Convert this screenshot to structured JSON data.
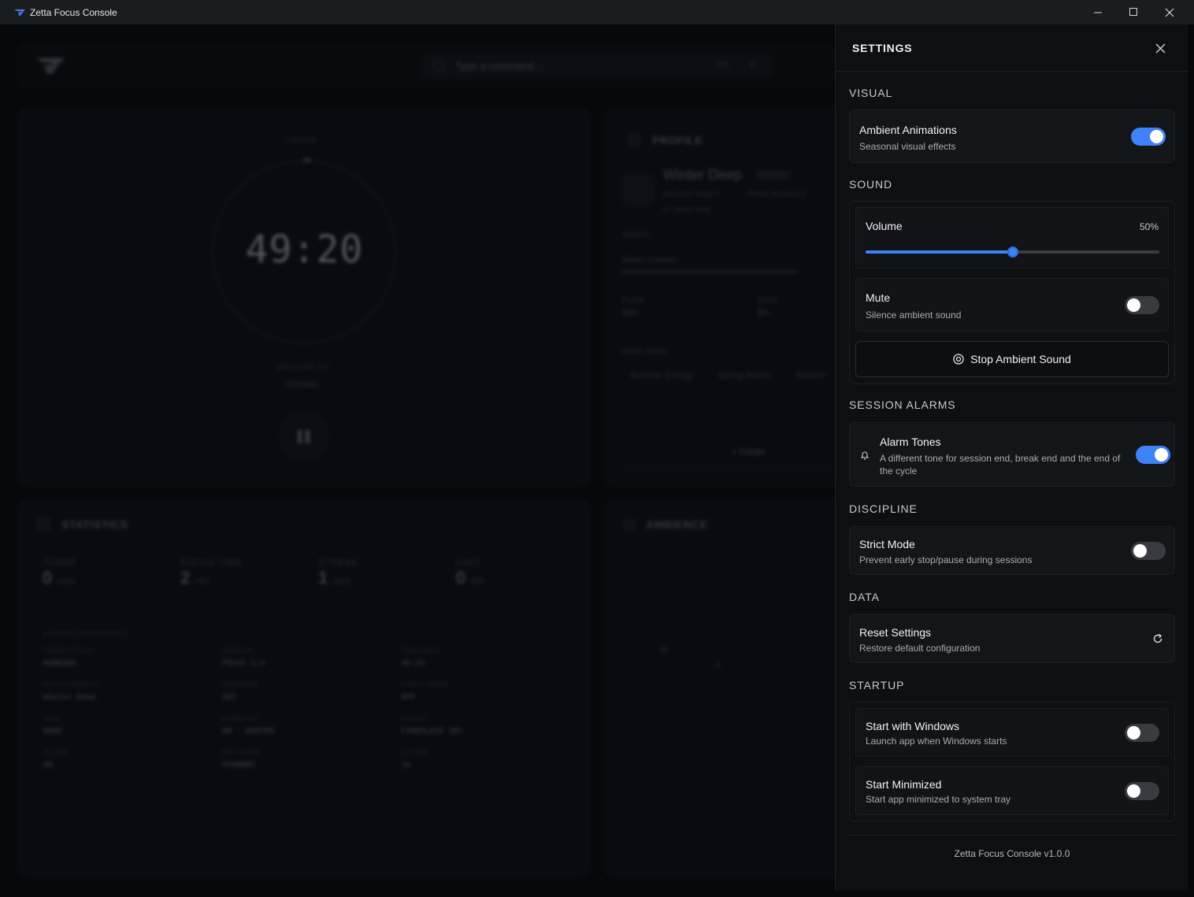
{
  "window": {
    "title": "Zetta Focus Console",
    "controls": [
      "minimize",
      "maximize",
      "close"
    ]
  },
  "background": {
    "command_placeholder": "Type a command...",
    "command_shortcut": "Ctrl",
    "command_shortcut_key": "K",
    "timer": {
      "label": "FOCUS",
      "time": "49:20",
      "session": "SESSION 1/3",
      "badge": "OVERRIDE"
    },
    "profile": {
      "heading": "PROFILE",
      "name": "Winter Deep",
      "badge": "PRESET",
      "sessions_today": "Sessions Today  0",
      "profile_sessions": "Profile Sessions  4",
      "id": "ID: winter-deep",
      "season_label": "Season",
      "motion_label": "Motion Intensity",
      "focus_label": "Focus",
      "focus_value": "25m",
      "short_label": "Short",
      "short_value": "5m",
      "quick_switch_label": "Quick Switch",
      "quick_switch": [
        "Summer Energy",
        "Spring Bloom",
        "Autumn"
      ],
      "create_label": "+  Create"
    },
    "statistics": {
      "heading": "STATISTICS",
      "items": [
        {
          "label": "TODAY",
          "value": "0",
          "unit": "sess"
        },
        {
          "label": "FOCUS TIME",
          "value": "2",
          "unit": "min"
        },
        {
          "label": "STREAK",
          "value": "1",
          "unit": "days"
        },
        {
          "label": "LAST",
          "value": "0",
          "unit": "min"
        }
      ],
      "diagnostics_heading": "● ENGINE DIAGNOSTICS",
      "diagnostics": [
        {
          "k": "TIMER STATUS",
          "v": "RUNNING"
        },
        {
          "k": "SESSION",
          "v": "FOCUS 1/3"
        },
        {
          "k": "REMAINING",
          "v": "49:20"
        },
        {
          "k": "ACTIVE PROFILE",
          "v": "Winter Deep"
        },
        {
          "k": "OVERRIDE",
          "v": "SET"
        },
        {
          "k": "STRICT MODE",
          "v": "OFF"
        },
        {
          "k": "TASK",
          "v": "NONE"
        },
        {
          "k": "AMBIENCE",
          "v": "ON · WINTER"
        },
        {
          "k": "SOUND",
          "v": "FIREPLACE 50%"
        },
        {
          "k": "ALARM",
          "v": "ON"
        },
        {
          "k": "DEV MODE",
          "v": "STANDBY"
        },
        {
          "k": "UPTIME",
          "v": "1m"
        }
      ]
    },
    "ambience": {
      "heading": "AMBIENCE"
    }
  },
  "settings": {
    "title": "SETTINGS",
    "visual": {
      "heading": "VISUAL",
      "ambient_title": "Ambient Animations",
      "ambient_sub": "Seasonal visual effects",
      "ambient_on": true
    },
    "sound": {
      "heading": "SOUND",
      "volume_label": "Volume",
      "volume_text": "50%",
      "volume": 0.5,
      "mute_title": "Mute",
      "mute_sub": "Silence ambient sound",
      "mute_on": false,
      "stop_label": "Stop Ambient Sound"
    },
    "alarms": {
      "heading": "SESSION ALARMS",
      "title": "Alarm Tones",
      "sub": "A different tone for session end, break end and the end of the cycle",
      "on": true
    },
    "discipline": {
      "heading": "DISCIPLINE",
      "title": "Strict Mode",
      "sub": "Prevent early stop/pause during sessions",
      "on": false
    },
    "data": {
      "heading": "DATA",
      "title": "Reset Settings",
      "sub": "Restore default configuration"
    },
    "startup": {
      "heading": "STARTUP",
      "windows_title": "Start with Windows",
      "windows_sub": "Launch app when Windows starts",
      "windows_on": false,
      "minimized_title": "Start Minimized",
      "minimized_sub": "Start app minimized to system tray",
      "minimized_on": false
    },
    "footer": "Zetta Focus Console v1.0.0"
  },
  "colors": {
    "accent": "#3d82f6",
    "panel_bg": "#0e0f12",
    "card_bg": "#141519"
  }
}
